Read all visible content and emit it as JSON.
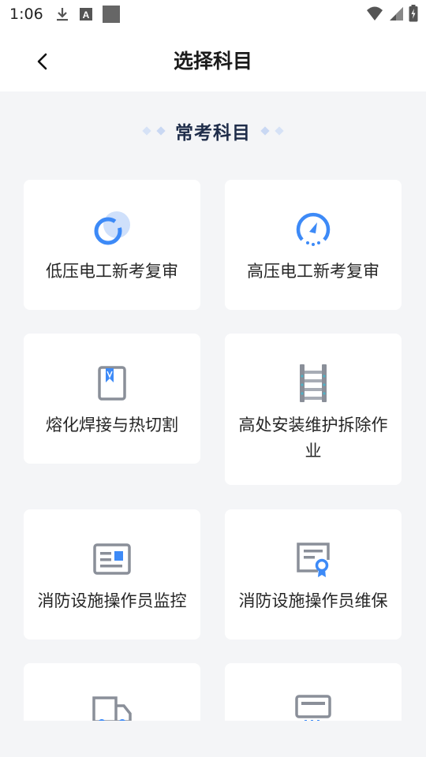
{
  "status": {
    "time": "1:06"
  },
  "header": {
    "title": "选择科目"
  },
  "section": {
    "title": "常考科目"
  },
  "subjects": [
    {
      "label": "低压电工新考复审",
      "icon": "circle-bubble-icon"
    },
    {
      "label": "高压电工新考复审",
      "icon": "gauge-icon"
    },
    {
      "label": "熔化焊接与热切割",
      "icon": "bookmark-book-icon"
    },
    {
      "label": "高处安装维护拆除作业",
      "icon": "ladder-icon"
    },
    {
      "label": "消防设施操作员监控",
      "icon": "id-card-icon"
    },
    {
      "label": "消防设施操作员维保",
      "icon": "certificate-icon"
    },
    {
      "label": "",
      "icon": "truck-icon"
    },
    {
      "label": "",
      "icon": "machine-icon"
    }
  ],
  "colors": {
    "accent": "#3d8af7",
    "card_bg": "#ffffff",
    "page_bg": "#f4f5f7",
    "icon_gray": "#8a8f99"
  }
}
